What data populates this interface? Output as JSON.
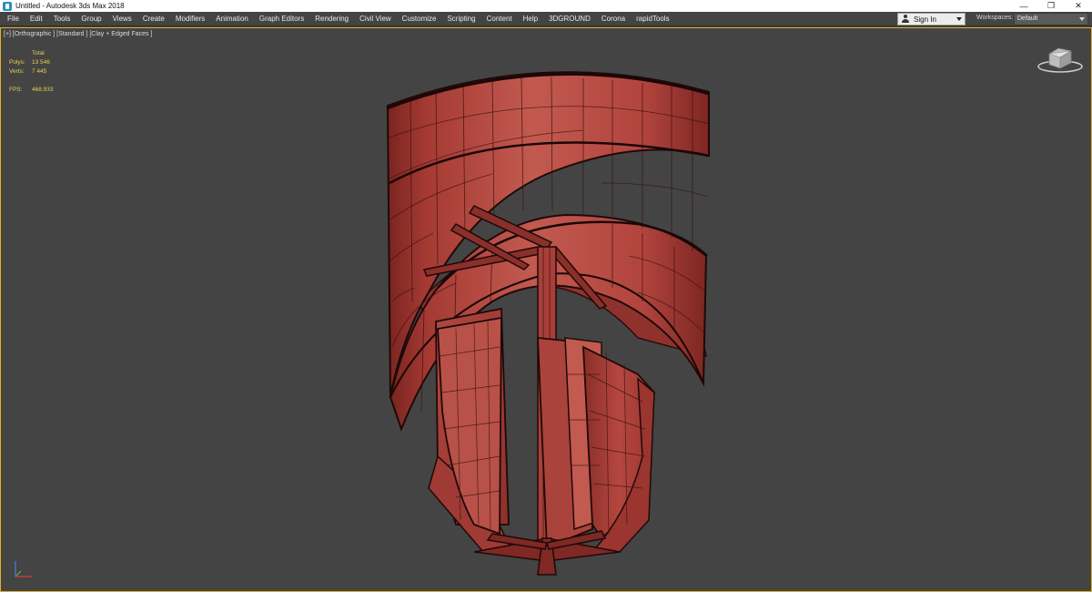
{
  "window": {
    "title": "Untitled - Autodesk 3ds Max 2018",
    "app_icon": "3ds-max-icon",
    "controls": [
      "minimize-icon",
      "restore-icon",
      "close-icon"
    ]
  },
  "menu": {
    "items": [
      "File",
      "Edit",
      "Tools",
      "Group",
      "Views",
      "Create",
      "Modifiers",
      "Animation",
      "Graph Editors",
      "Rendering",
      "Civil View",
      "Customize",
      "Scripting",
      "Content",
      "Help",
      "3DGROUND",
      "Corona",
      "rapidTools"
    ],
    "sign_in": "Sign In",
    "workspaces_label": "Workspaces:",
    "workspace_value": "Default"
  },
  "viewport": {
    "label": "[+] [Orthographic ] [Standard ] [Clay + Edged Faces ]",
    "stats": {
      "header": "Total",
      "polys_label": "Polys:",
      "polys_value": "13 546",
      "verts_label": "Verts:",
      "verts_value": "7 445",
      "fps_label": "FPS:",
      "fps_value": "468,933"
    },
    "model": "clay-edged-faces-lamp-model",
    "colors": {
      "background": "#444444",
      "border": "#e0b020",
      "clay": "#b5473f",
      "stats": "#e6d24a"
    }
  }
}
